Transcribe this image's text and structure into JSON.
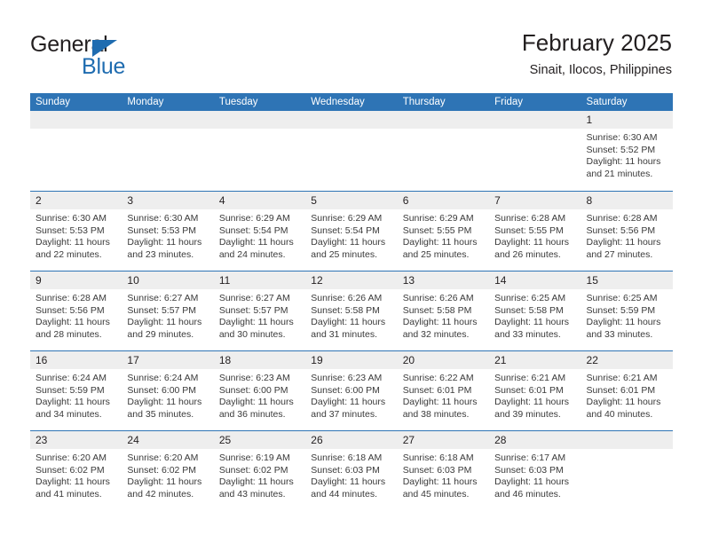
{
  "brand": {
    "name_part1": "General",
    "name_part2": "Blue",
    "triangle_color": "#1f6cb0"
  },
  "header": {
    "title": "February 2025",
    "subtitle": "Sinait, Ilocos, Philippines",
    "accent_color": "#2e74b5",
    "day_band_color": "#eeeeee"
  },
  "weekdays": [
    "Sunday",
    "Monday",
    "Tuesday",
    "Wednesday",
    "Thursday",
    "Friday",
    "Saturday"
  ],
  "weeks": [
    [
      {
        "day": "",
        "sunrise": "",
        "sunset": "",
        "daylight": ""
      },
      {
        "day": "",
        "sunrise": "",
        "sunset": "",
        "daylight": ""
      },
      {
        "day": "",
        "sunrise": "",
        "sunset": "",
        "daylight": ""
      },
      {
        "day": "",
        "sunrise": "",
        "sunset": "",
        "daylight": ""
      },
      {
        "day": "",
        "sunrise": "",
        "sunset": "",
        "daylight": ""
      },
      {
        "day": "",
        "sunrise": "",
        "sunset": "",
        "daylight": ""
      },
      {
        "day": "1",
        "sunrise": "Sunrise: 6:30 AM",
        "sunset": "Sunset: 5:52 PM",
        "daylight": "Daylight: 11 hours and 21 minutes."
      }
    ],
    [
      {
        "day": "2",
        "sunrise": "Sunrise: 6:30 AM",
        "sunset": "Sunset: 5:53 PM",
        "daylight": "Daylight: 11 hours and 22 minutes."
      },
      {
        "day": "3",
        "sunrise": "Sunrise: 6:30 AM",
        "sunset": "Sunset: 5:53 PM",
        "daylight": "Daylight: 11 hours and 23 minutes."
      },
      {
        "day": "4",
        "sunrise": "Sunrise: 6:29 AM",
        "sunset": "Sunset: 5:54 PM",
        "daylight": "Daylight: 11 hours and 24 minutes."
      },
      {
        "day": "5",
        "sunrise": "Sunrise: 6:29 AM",
        "sunset": "Sunset: 5:54 PM",
        "daylight": "Daylight: 11 hours and 25 minutes."
      },
      {
        "day": "6",
        "sunrise": "Sunrise: 6:29 AM",
        "sunset": "Sunset: 5:55 PM",
        "daylight": "Daylight: 11 hours and 25 minutes."
      },
      {
        "day": "7",
        "sunrise": "Sunrise: 6:28 AM",
        "sunset": "Sunset: 5:55 PM",
        "daylight": "Daylight: 11 hours and 26 minutes."
      },
      {
        "day": "8",
        "sunrise": "Sunrise: 6:28 AM",
        "sunset": "Sunset: 5:56 PM",
        "daylight": "Daylight: 11 hours and 27 minutes."
      }
    ],
    [
      {
        "day": "9",
        "sunrise": "Sunrise: 6:28 AM",
        "sunset": "Sunset: 5:56 PM",
        "daylight": "Daylight: 11 hours and 28 minutes."
      },
      {
        "day": "10",
        "sunrise": "Sunrise: 6:27 AM",
        "sunset": "Sunset: 5:57 PM",
        "daylight": "Daylight: 11 hours and 29 minutes."
      },
      {
        "day": "11",
        "sunrise": "Sunrise: 6:27 AM",
        "sunset": "Sunset: 5:57 PM",
        "daylight": "Daylight: 11 hours and 30 minutes."
      },
      {
        "day": "12",
        "sunrise": "Sunrise: 6:26 AM",
        "sunset": "Sunset: 5:58 PM",
        "daylight": "Daylight: 11 hours and 31 minutes."
      },
      {
        "day": "13",
        "sunrise": "Sunrise: 6:26 AM",
        "sunset": "Sunset: 5:58 PM",
        "daylight": "Daylight: 11 hours and 32 minutes."
      },
      {
        "day": "14",
        "sunrise": "Sunrise: 6:25 AM",
        "sunset": "Sunset: 5:58 PM",
        "daylight": "Daylight: 11 hours and 33 minutes."
      },
      {
        "day": "15",
        "sunrise": "Sunrise: 6:25 AM",
        "sunset": "Sunset: 5:59 PM",
        "daylight": "Daylight: 11 hours and 33 minutes."
      }
    ],
    [
      {
        "day": "16",
        "sunrise": "Sunrise: 6:24 AM",
        "sunset": "Sunset: 5:59 PM",
        "daylight": "Daylight: 11 hours and 34 minutes."
      },
      {
        "day": "17",
        "sunrise": "Sunrise: 6:24 AM",
        "sunset": "Sunset: 6:00 PM",
        "daylight": "Daylight: 11 hours and 35 minutes."
      },
      {
        "day": "18",
        "sunrise": "Sunrise: 6:23 AM",
        "sunset": "Sunset: 6:00 PM",
        "daylight": "Daylight: 11 hours and 36 minutes."
      },
      {
        "day": "19",
        "sunrise": "Sunrise: 6:23 AM",
        "sunset": "Sunset: 6:00 PM",
        "daylight": "Daylight: 11 hours and 37 minutes."
      },
      {
        "day": "20",
        "sunrise": "Sunrise: 6:22 AM",
        "sunset": "Sunset: 6:01 PM",
        "daylight": "Daylight: 11 hours and 38 minutes."
      },
      {
        "day": "21",
        "sunrise": "Sunrise: 6:21 AM",
        "sunset": "Sunset: 6:01 PM",
        "daylight": "Daylight: 11 hours and 39 minutes."
      },
      {
        "day": "22",
        "sunrise": "Sunrise: 6:21 AM",
        "sunset": "Sunset: 6:01 PM",
        "daylight": "Daylight: 11 hours and 40 minutes."
      }
    ],
    [
      {
        "day": "23",
        "sunrise": "Sunrise: 6:20 AM",
        "sunset": "Sunset: 6:02 PM",
        "daylight": "Daylight: 11 hours and 41 minutes."
      },
      {
        "day": "24",
        "sunrise": "Sunrise: 6:20 AM",
        "sunset": "Sunset: 6:02 PM",
        "daylight": "Daylight: 11 hours and 42 minutes."
      },
      {
        "day": "25",
        "sunrise": "Sunrise: 6:19 AM",
        "sunset": "Sunset: 6:02 PM",
        "daylight": "Daylight: 11 hours and 43 minutes."
      },
      {
        "day": "26",
        "sunrise": "Sunrise: 6:18 AM",
        "sunset": "Sunset: 6:03 PM",
        "daylight": "Daylight: 11 hours and 44 minutes."
      },
      {
        "day": "27",
        "sunrise": "Sunrise: 6:18 AM",
        "sunset": "Sunset: 6:03 PM",
        "daylight": "Daylight: 11 hours and 45 minutes."
      },
      {
        "day": "28",
        "sunrise": "Sunrise: 6:17 AM",
        "sunset": "Sunset: 6:03 PM",
        "daylight": "Daylight: 11 hours and 46 minutes."
      },
      {
        "day": "",
        "sunrise": "",
        "sunset": "",
        "daylight": ""
      }
    ]
  ]
}
